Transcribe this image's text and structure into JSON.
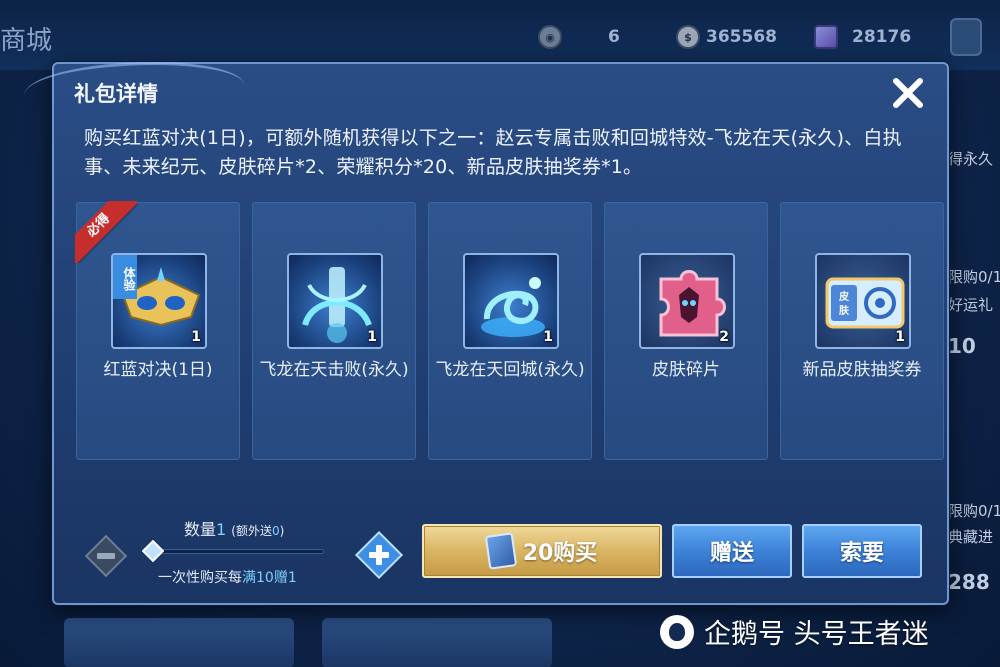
{
  "background": {
    "store_title": "商城",
    "currencies": [
      {
        "icon": "token-icon",
        "value": "6"
      },
      {
        "icon": "gold-coin-icon",
        "value": "365568"
      },
      {
        "icon": "diamond-gem-icon",
        "value": "28176"
      }
    ],
    "right_fragments": [
      "得永久",
      "限购0/1",
      "好运礼",
      "10",
      "限购0/1",
      "典藏进",
      "288"
    ]
  },
  "dialog": {
    "title": "礼包详情",
    "description": "购买红蓝对决(1日)，可额外随机获得以下之一：赵云专属击败和回城特效-飞龙在天(永久)、白执事、未来纪元、皮肤碎片*2、荣耀积分*20、新品皮肤抽奖券*1。",
    "guaranteed_badge": "必得",
    "trial_tag": "体验",
    "rewards": [
      {
        "name": "红蓝对决(1日)",
        "qty": "1",
        "icon": "mask-icon"
      },
      {
        "name": "飞龙在天击败(永久)",
        "qty": "1",
        "icon": "dragon-scroll-icon"
      },
      {
        "name": "飞龙在天回城(永久)",
        "qty": "1",
        "icon": "dragon-recall-icon"
      },
      {
        "name": "皮肤碎片",
        "qty": "2",
        "icon": "skin-fragment-icon"
      },
      {
        "name": "新品皮肤抽奖券",
        "qty": "1",
        "icon": "skin-ticket-icon"
      }
    ],
    "quantity": {
      "label": "数量",
      "value": "1",
      "extra_prefix": "(额外送",
      "extra_value": "0",
      "extra_suffix": ")",
      "bulk_prefix": "一次性购买每",
      "bulk_highlight": "满10赠1"
    },
    "buttons": {
      "buy": "20购买",
      "gift": "赠送",
      "ask": "索要"
    }
  },
  "watermark": "企鹅号 头号王者迷",
  "colors": {
    "dialog_bg": "#2a4d86",
    "gold_button": "#d9b563",
    "blue_button": "#3a7fd6",
    "highlight": "#7fd0ff",
    "badge_red": "#c62d2d"
  }
}
